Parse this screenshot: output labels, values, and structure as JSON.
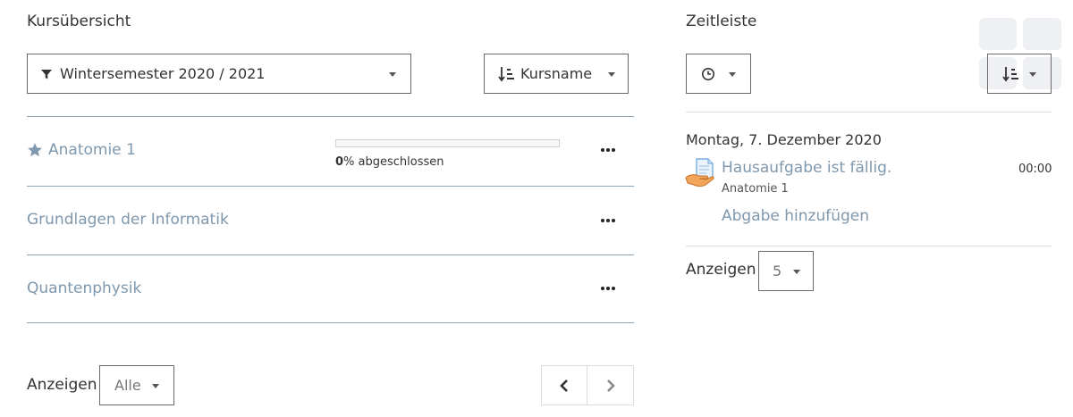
{
  "overview": {
    "title": "Kursübersicht",
    "filter_label": "Wintersemester 2020 / 2021",
    "sort_label": "Kursname",
    "courses": [
      {
        "name": "Anatomie 1",
        "starred": true,
        "progress_percent": "0",
        "progress_suffix": "% abgeschlossen",
        "progress_fraction": 0
      },
      {
        "name": "Grundlagen der Informatik",
        "starred": false
      },
      {
        "name": "Quantenphysik",
        "starred": false
      }
    ],
    "show_label": "Anzeigen",
    "show_value": "Alle"
  },
  "timeline": {
    "title": "Zeitleiste",
    "date_heading": "Montag, 7. Dezember 2020",
    "event": {
      "title": "Hausaufgabe ist fällig.",
      "course": "Anatomie 1",
      "time": "00:00",
      "action": "Abgabe hinzufügen"
    },
    "show_label": "Anzeigen",
    "show_value": "5"
  },
  "colors": {
    "link": "#7f98ad",
    "divider": "#8ca4b8"
  }
}
